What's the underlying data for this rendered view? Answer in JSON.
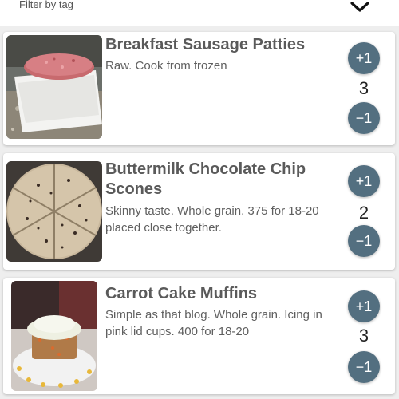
{
  "filter": {
    "label": "Filter by tag",
    "toggle_icon": "chevron-down-icon"
  },
  "theme": {
    "button_color": "#536f80",
    "title_color": "#5a5a5a",
    "background": "#eeeeee"
  },
  "items": [
    {
      "title": "Breakfast Sausage Patties",
      "description": "Raw. Cook from frozen",
      "increment_label": "+1",
      "decrement_label": "−1",
      "count": "3",
      "image": "sausage-patties-photo"
    },
    {
      "title": "Buttermilk Chocolate Chip Scones",
      "description": "Skinny taste. Whole grain. 375 for 18-20 placed close together.",
      "increment_label": "+1",
      "decrement_label": "−1",
      "count": "2",
      "image": "scones-photo"
    },
    {
      "title": "Carrot Cake Muffins",
      "description": "Simple as that blog. Whole grain. Icing in pink lid cups. 400 for 18-20",
      "increment_label": "+1",
      "decrement_label": "−1",
      "count": "3",
      "image": "carrot-cake-muffin-photo"
    }
  ]
}
